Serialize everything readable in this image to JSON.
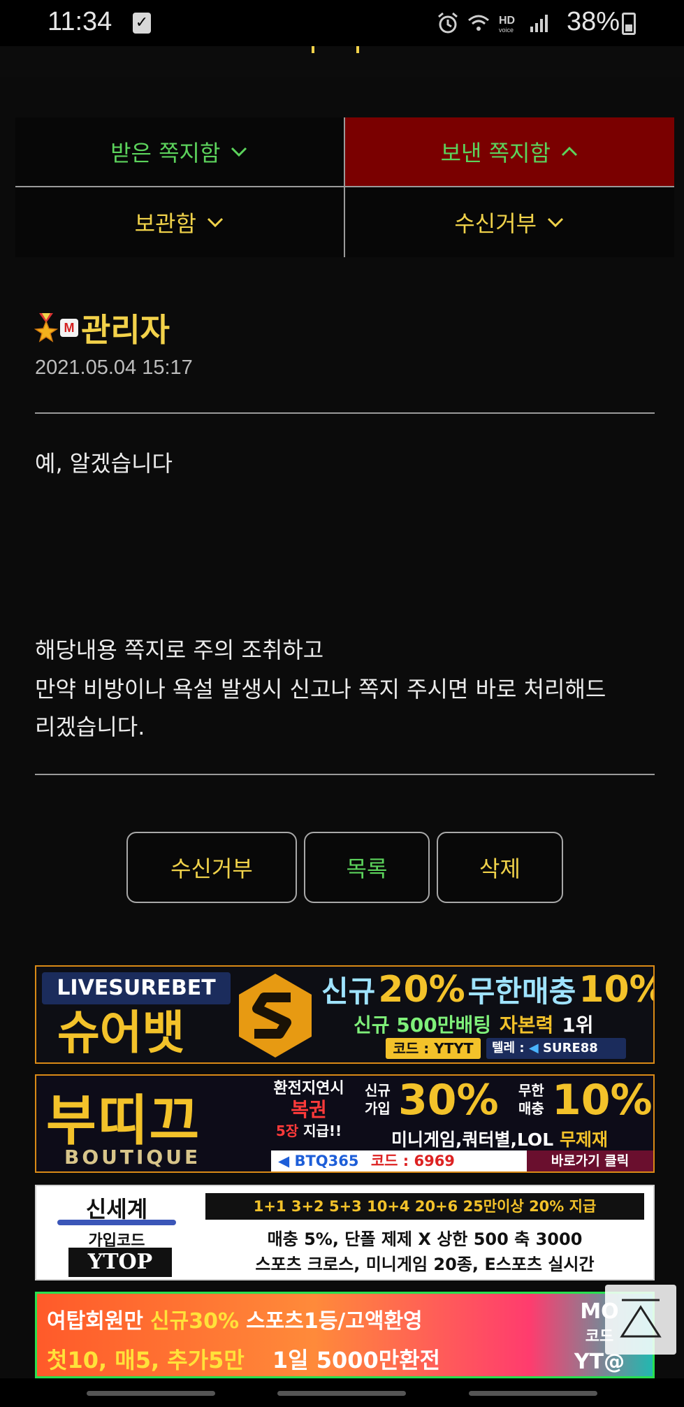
{
  "status": {
    "time": "11:34",
    "battery": "38%",
    "network": "HD"
  },
  "tabs": [
    {
      "label": "받은 쪽지함",
      "state": "collapsed"
    },
    {
      "label": "보낸 쪽지함",
      "state": "expanded"
    },
    {
      "label": "보관함",
      "state": "collapsed"
    },
    {
      "label": "수신거부",
      "state": "collapsed"
    }
  ],
  "message": {
    "author": "관리자",
    "badge": "M",
    "date": "2021.05.04 15:17",
    "line1": "예, 알겠습니다",
    "line2": "해당내용 쪽지로 주의 조취하고",
    "line3": "만약 비방이나 욕설 발생시 신고나 쪽지 주시면 바로 처리해드",
    "line4": "리겠습니다."
  },
  "actions": {
    "block_label": "수신거부",
    "list_label": "목록",
    "delete_label": "삭제"
  },
  "banners": {
    "b1": {
      "brand": "LIVESUREBET",
      "name": "슈어뱃",
      "headline_a": "신규",
      "headline_b": "20%",
      "headline_c": "무한매충",
      "headline_d": "10%",
      "sub_a": "신규 500만배팅",
      "sub_b": "자본력",
      "sub_c": "1위",
      "code_label": "코드 : YTYT",
      "tele_label": "텔레 :",
      "tele_id": "SURE88"
    },
    "b2": {
      "name": "부띠끄",
      "sub": "BOUTIQUE",
      "col_a1": "환전지연시",
      "col_a2": "복권",
      "col_a3": "5장",
      "col_a4": "지급!!",
      "new_label_1": "신규",
      "new_label_2": "가입",
      "pct_a": "30%",
      "unl_1": "무한",
      "unl_2": "매충",
      "pct_b": "10%",
      "games": "미니게임,쿼터별,LOL",
      "unlimited": "무제재",
      "tele": "BTQ365",
      "code": "코드 : 6969",
      "goto": "바로가기 클릭"
    },
    "b3": {
      "brand": "신세계",
      "join_code_label": "가입코드",
      "join_code": "YTOP",
      "row1": "1+1 3+2 5+3 10+4 20+6 25만이상 20% 지급",
      "row2": "매충 5%, 단폴 제제 X 상한 500 축 3000",
      "row3": "스포츠 크로스, 미니게임 20종, E스포츠 실시간"
    },
    "b4": {
      "row1_a": "여탑회원만",
      "row1_b": "신규30%",
      "row1_c": "스포츠1등/고액환영",
      "row2_a": "첫10, 매5, 추가5만",
      "row2_b": "1일 5000만환전",
      "side_a": "MO",
      "side_b": "코드",
      "side_c": "YT@"
    }
  },
  "colors": {
    "accent_yellow": "#f0d24a",
    "accent_green": "#5cd35c",
    "active_tab": "#7a0000"
  }
}
